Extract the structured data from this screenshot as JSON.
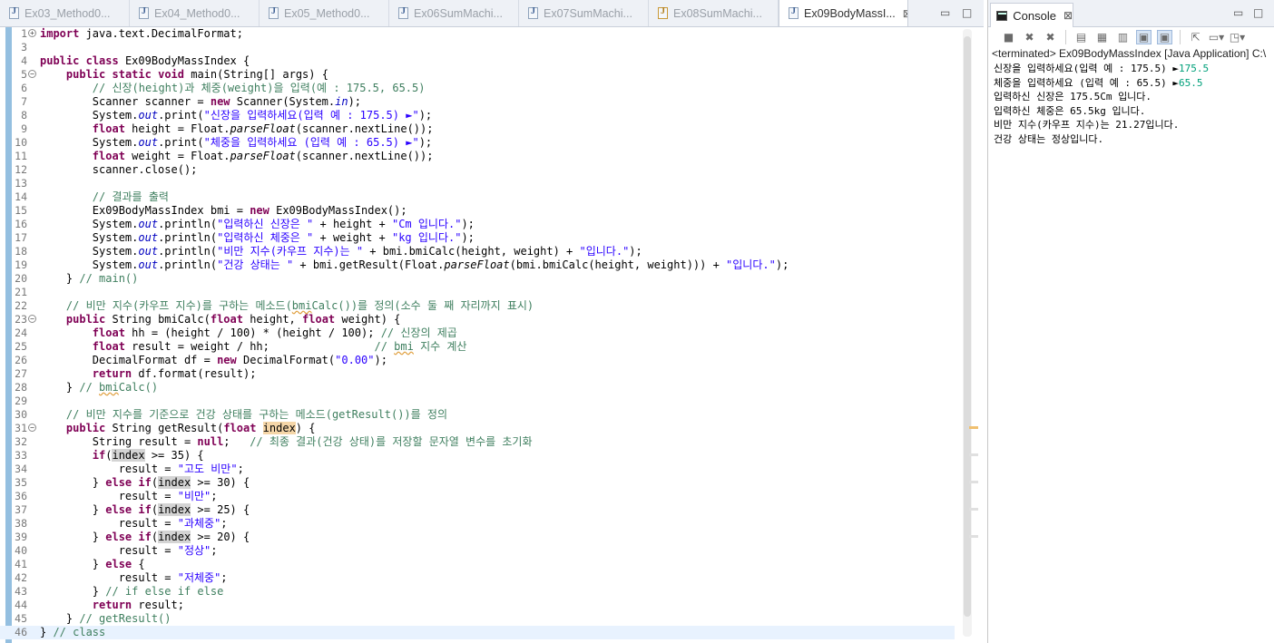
{
  "editor": {
    "tabs": [
      {
        "label": "Ex03_Method0...",
        "active": false,
        "icon": "java-file-icon"
      },
      {
        "label": "Ex04_Method0...",
        "active": false,
        "icon": "java-file-icon"
      },
      {
        "label": "Ex05_Method0...",
        "active": false,
        "icon": "java-file-icon"
      },
      {
        "label": "Ex06SumMachi...",
        "active": false,
        "icon": "java-file-icon"
      },
      {
        "label": "Ex07SumMachi...",
        "active": false,
        "icon": "java-file-icon"
      },
      {
        "label": "Ex08SumMachi...",
        "active": false,
        "icon": "java-file-warning-icon"
      },
      {
        "label": "Ex09BodyMassI...",
        "active": true,
        "icon": "java-file-icon",
        "close": "⊠"
      }
    ],
    "minimize_glyph": "▭",
    "maximize_glyph": "□",
    "lines": [
      {
        "n": "1",
        "fold": "+",
        "code": "import java.text.DecimalFormat;"
      },
      {
        "n": "3",
        "code": ""
      },
      {
        "n": "4",
        "code": "public class Ex09BodyMassIndex {"
      },
      {
        "n": "5",
        "fold": "-",
        "code": "    public static void main(String[] args) {"
      },
      {
        "n": "6",
        "code": "        // 신장(height)과 체중(weight)을 입력(예 : 175.5, 65.5)"
      },
      {
        "n": "7",
        "code": "        Scanner scanner = new Scanner(System.in);"
      },
      {
        "n": "8",
        "code": "        System.out.print(\"신장을 입력하세요(입력 예 : 175.5) ►\");"
      },
      {
        "n": "9",
        "code": "        float height = Float.parseFloat(scanner.nextLine());"
      },
      {
        "n": "10",
        "code": "        System.out.print(\"체중을 입력하세요 (입력 예 : 65.5) ►\");"
      },
      {
        "n": "11",
        "code": "        float weight = Float.parseFloat(scanner.nextLine());"
      },
      {
        "n": "12",
        "code": "        scanner.close();"
      },
      {
        "n": "13",
        "code": ""
      },
      {
        "n": "14",
        "code": "        // 결과를 출력"
      },
      {
        "n": "15",
        "code": "        Ex09BodyMassIndex bmi = new Ex09BodyMassIndex();"
      },
      {
        "n": "16",
        "code": "        System.out.println(\"입력하신 신장은 \" + height + \"Cm 입니다.\");"
      },
      {
        "n": "17",
        "code": "        System.out.println(\"입력하신 체중은 \" + weight + \"kg 입니다.\");"
      },
      {
        "n": "18",
        "code": "        System.out.println(\"비만 지수(카우프 지수)는 \" + bmi.bmiCalc(height, weight) + \"입니다.\");"
      },
      {
        "n": "19",
        "code": "        System.out.println(\"건강 상태는 \" + bmi.getResult(Float.parseFloat(bmi.bmiCalc(height, weight))) + \"입니다.\");"
      },
      {
        "n": "20",
        "code": "    } // main()"
      },
      {
        "n": "21",
        "code": ""
      },
      {
        "n": "22",
        "code": "    // 비만 지수(카우프 지수)를 구하는 메소드(bmiCalc())를 정의(소수 둘 째 자리까지 표시)"
      },
      {
        "n": "23",
        "fold": "-",
        "code": "    public String bmiCalc(float height, float weight) {"
      },
      {
        "n": "24",
        "code": "        float hh = (height / 100) * (height / 100); // 신장의 제곱"
      },
      {
        "n": "25",
        "code": "        float result = weight / hh;                // bmi 지수 계산"
      },
      {
        "n": "26",
        "code": "        DecimalFormat df = new DecimalFormat(\"0.00\");"
      },
      {
        "n": "27",
        "code": "        return df.format(result);"
      },
      {
        "n": "28",
        "code": "    } // bmiCalc()"
      },
      {
        "n": "29",
        "code": ""
      },
      {
        "n": "30",
        "code": "    // 비만 지수를 기준으로 건강 상태를 구하는 메소드(getResult())를 정의"
      },
      {
        "n": "31",
        "fold": "-",
        "code": "    public String getResult(float index) {"
      },
      {
        "n": "32",
        "code": "        String result = null;   // 최종 결과(건강 상태)를 저장할 문자열 변수를 초기화"
      },
      {
        "n": "33",
        "code": "        if(index >= 35) {"
      },
      {
        "n": "34",
        "code": "            result = \"고도 비만\";"
      },
      {
        "n": "35",
        "code": "        } else if(index >= 30) {"
      },
      {
        "n": "36",
        "code": "            result = \"비만\";"
      },
      {
        "n": "37",
        "code": "        } else if(index >= 25) {"
      },
      {
        "n": "38",
        "code": "            result = \"과체중\";"
      },
      {
        "n": "39",
        "code": "        } else if(index >= 20) {"
      },
      {
        "n": "40",
        "code": "            result = \"정상\";"
      },
      {
        "n": "41",
        "code": "        } else {"
      },
      {
        "n": "42",
        "code": "            result = \"저체중\";"
      },
      {
        "n": "43",
        "code": "        } // if else if else"
      },
      {
        "n": "44",
        "code": "        return result;"
      },
      {
        "n": "45",
        "code": "    } // getResult()"
      },
      {
        "n": "46",
        "code": "} // class"
      }
    ]
  },
  "console": {
    "tab_label": "Console",
    "tab_close": "⊠",
    "status": "<terminated> Ex09BodyMassIndex [Java Application] C:\\",
    "output": [
      {
        "text": "신장을 입력하세요(입력 예 : 175.5) ►",
        "input": "175.5"
      },
      {
        "text": "체중을 입력하세요 (입력 예 : 65.5) ►",
        "input": "65.5"
      },
      {
        "text": "입력하신 신장은 175.5Cm 입니다.",
        "input": ""
      },
      {
        "text": "입력하신 체중은 65.5kg 입니다.",
        "input": ""
      },
      {
        "text": "비만 지수(카우프 지수)는 21.27입니다.",
        "input": ""
      },
      {
        "text": "건강 상태는 정상입니다.",
        "input": ""
      }
    ],
    "toolbar_icons": [
      "terminate-icon",
      "remove-launch-icon",
      "remove-all-terminated-icon",
      "clear-console-icon",
      "scroll-lock-icon",
      "word-wrap-icon",
      "show-on-stdout-icon",
      "show-on-stderr-icon",
      "pin-console-icon",
      "display-selected-console-icon",
      "open-console-icon"
    ]
  }
}
